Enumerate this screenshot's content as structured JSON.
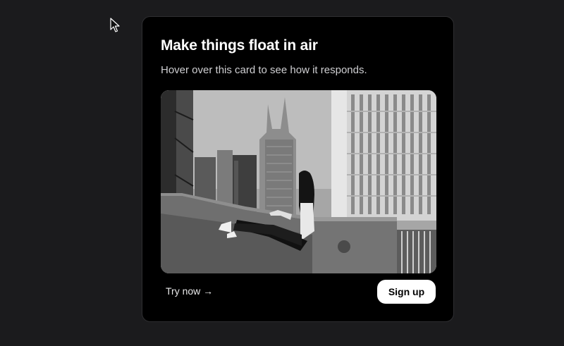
{
  "card": {
    "title": "Make things float in air",
    "subtitle": "Hover over this card to see how it responds.",
    "image": {
      "subject": "woman-sitting-on-rooftop-ledge-city-skyline",
      "tone": "black-and-white"
    },
    "try_now_label": "Try now →",
    "sign_up_label": "Sign up"
  },
  "cursor": {
    "icon": "arrow-pointer-icon"
  },
  "colors": {
    "page_background": "#1b1b1d",
    "card_background": "#000000",
    "card_border": "#2e2e31",
    "title": "#ffffff",
    "subtitle": "#cfcfd2",
    "button_background": "#ffffff",
    "button_text": "#000000"
  }
}
